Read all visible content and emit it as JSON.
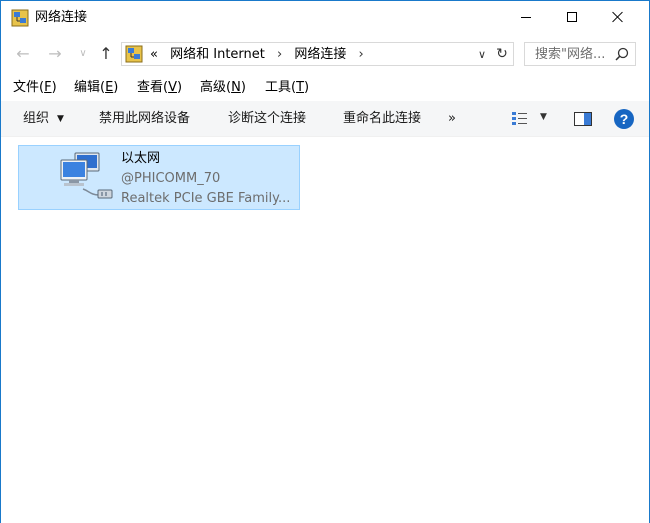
{
  "window": {
    "title": "网络连接",
    "controls": {
      "minimize": "minimize-icon",
      "maximize": "maximize-icon",
      "close": "close-icon"
    }
  },
  "address_bar": {
    "overflow": "«",
    "crumbs": [
      "网络和 Internet",
      "网络连接"
    ],
    "separator": "›",
    "search_placeholder": "搜索\"网络..."
  },
  "menu": [
    {
      "label": "文件(",
      "accel": "F",
      "close": ")"
    },
    {
      "label": "编辑(",
      "accel": "E",
      "close": ")"
    },
    {
      "label": "查看(",
      "accel": "V",
      "close": ")"
    },
    {
      "label": "高级(",
      "accel": "N",
      "close": ")"
    },
    {
      "label": "工具(",
      "accel": "T",
      "close": ")"
    }
  ],
  "toolbar": {
    "organize": "组织",
    "disable": "禁用此网络设备",
    "diagnose": "诊断这个连接",
    "rename": "重命名此连接",
    "more": "»",
    "help": "?"
  },
  "connection": {
    "name": "以太网",
    "status": "@PHICOMM_70",
    "device": "Realtek PCIe GBE Family..."
  },
  "colors": {
    "selection_bg": "#cce8ff",
    "selection_border": "#99d1ff",
    "help_blue": "#1766c2",
    "window_border": "#1979ca"
  }
}
